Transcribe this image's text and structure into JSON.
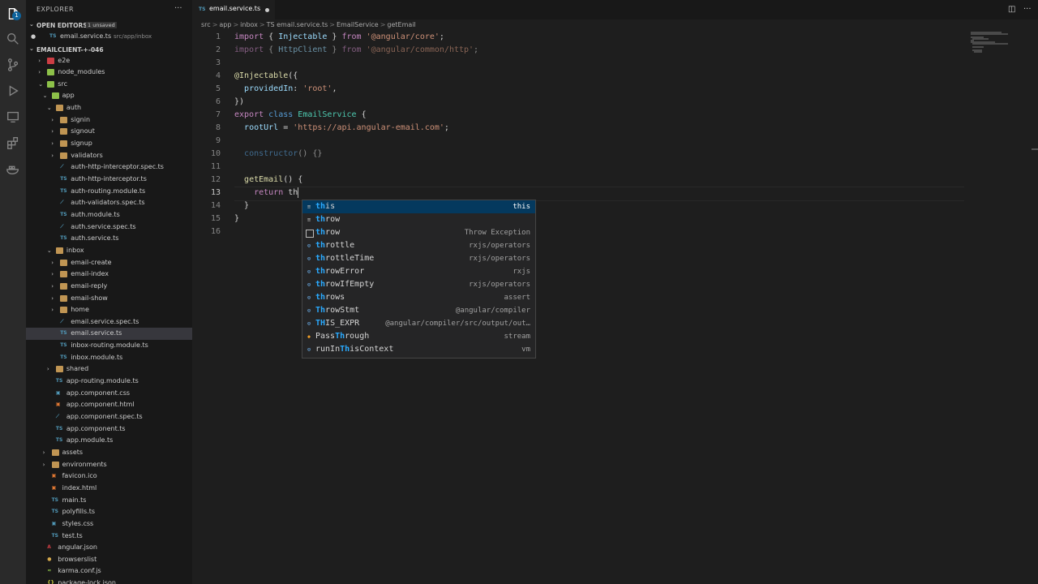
{
  "explorer": {
    "title": "EXPLORER",
    "more": "···",
    "open_editors": {
      "title": "OPEN EDITORS",
      "badge": "1 unsaved",
      "file": "email.service.ts",
      "path": "src/app/inbox",
      "dot": "●"
    },
    "project": "EMAILCLIENT-+-046",
    "tree": [
      {
        "label": "e2e",
        "type": "folder",
        "color": "red",
        "indent": 1,
        "chev": "›"
      },
      {
        "label": "node_modules",
        "type": "folder",
        "color": "green",
        "indent": 1,
        "chev": "›"
      },
      {
        "label": "src",
        "type": "folder",
        "color": "green",
        "indent": 1,
        "chev": "⌄"
      },
      {
        "label": "app",
        "type": "folder",
        "color": "green",
        "indent": 2,
        "chev": "⌄"
      },
      {
        "label": "auth",
        "type": "folder",
        "color": "",
        "indent": 3,
        "chev": "⌄"
      },
      {
        "label": "signin",
        "type": "folder",
        "color": "",
        "indent": 4,
        "chev": "›"
      },
      {
        "label": "signout",
        "type": "folder",
        "color": "",
        "indent": 4,
        "chev": "›"
      },
      {
        "label": "signup",
        "type": "folder",
        "color": "",
        "indent": 4,
        "chev": "›"
      },
      {
        "label": "validators",
        "type": "folder",
        "color": "",
        "indent": 4,
        "chev": "›"
      },
      {
        "label": "auth-http-interceptor.spec.ts",
        "type": "spec",
        "indent": 4
      },
      {
        "label": "auth-http-interceptor.ts",
        "type": "ts",
        "indent": 4
      },
      {
        "label": "auth-routing.module.ts",
        "type": "ts",
        "indent": 4
      },
      {
        "label": "auth-validators.spec.ts",
        "type": "spec",
        "indent": 4
      },
      {
        "label": "auth.module.ts",
        "type": "ts",
        "indent": 4
      },
      {
        "label": "auth.service.spec.ts",
        "type": "spec",
        "indent": 4
      },
      {
        "label": "auth.service.ts",
        "type": "ts",
        "indent": 4
      },
      {
        "label": "inbox",
        "type": "folder",
        "color": "",
        "indent": 3,
        "chev": "⌄"
      },
      {
        "label": "email-create",
        "type": "folder",
        "color": "",
        "indent": 4,
        "chev": "›"
      },
      {
        "label": "email-index",
        "type": "folder",
        "color": "",
        "indent": 4,
        "chev": "›"
      },
      {
        "label": "email-reply",
        "type": "folder",
        "color": "",
        "indent": 4,
        "chev": "›"
      },
      {
        "label": "email-show",
        "type": "folder",
        "color": "",
        "indent": 4,
        "chev": "›"
      },
      {
        "label": "home",
        "type": "folder",
        "color": "",
        "indent": 4,
        "chev": "›"
      },
      {
        "label": "email.service.spec.ts",
        "type": "spec",
        "indent": 4
      },
      {
        "label": "email.service.ts",
        "type": "ts",
        "indent": 4,
        "selected": true
      },
      {
        "label": "inbox-routing.module.ts",
        "type": "ts",
        "indent": 4
      },
      {
        "label": "inbox.module.ts",
        "type": "ts",
        "indent": 4
      },
      {
        "label": "shared",
        "type": "folder",
        "color": "",
        "indent": 3,
        "chev": "›"
      },
      {
        "label": "app-routing.module.ts",
        "type": "ts",
        "indent": 3
      },
      {
        "label": "app.component.css",
        "type": "css",
        "indent": 3
      },
      {
        "label": "app.component.html",
        "type": "html",
        "indent": 3
      },
      {
        "label": "app.component.spec.ts",
        "type": "spec",
        "indent": 3
      },
      {
        "label": "app.component.ts",
        "type": "ts",
        "indent": 3
      },
      {
        "label": "app.module.ts",
        "type": "ts",
        "indent": 3
      },
      {
        "label": "assets",
        "type": "folder",
        "color": "",
        "indent": 2,
        "chev": "›"
      },
      {
        "label": "environments",
        "type": "folder",
        "color": "",
        "indent": 2,
        "chev": "›"
      },
      {
        "label": "favicon.ico",
        "type": "img",
        "indent": 2
      },
      {
        "label": "index.html",
        "type": "html",
        "indent": 2
      },
      {
        "label": "main.ts",
        "type": "ts",
        "indent": 2
      },
      {
        "label": "polyfills.ts",
        "type": "ts",
        "indent": 2
      },
      {
        "label": "styles.css",
        "type": "css",
        "indent": 2
      },
      {
        "label": "test.ts",
        "type": "ts",
        "indent": 2
      },
      {
        "label": "angular.json",
        "type": "angular",
        "indent": 1
      },
      {
        "label": "browserslist",
        "type": "circle",
        "indent": 1
      },
      {
        "label": "karma.conf.js",
        "type": "karma",
        "indent": 1
      },
      {
        "label": "package-lock.json",
        "type": "json",
        "indent": 1
      }
    ]
  },
  "tab": {
    "icon": "TS",
    "label": "email.service.ts"
  },
  "breadcrumb": [
    "src",
    ">",
    "app",
    ">",
    "inbox",
    ">",
    "TS email.service.ts",
    ">",
    "EmailService",
    ">",
    "getEmail"
  ],
  "code_lines": [
    {
      "n": "1",
      "tokens": [
        [
          "kw",
          "import"
        ],
        [
          "punc",
          " { "
        ],
        [
          "prop",
          "Injectable"
        ],
        [
          "punc",
          " } "
        ],
        [
          "kw",
          "from"
        ],
        [
          "punc",
          " "
        ],
        [
          "str",
          "'@angular/core'"
        ],
        [
          "punc",
          ";"
        ]
      ]
    },
    {
      "n": "2",
      "tokens": [
        [
          "kw",
          "import"
        ],
        [
          "punc",
          " { "
        ],
        [
          "prop",
          "HttpClient"
        ],
        [
          "punc",
          " } "
        ],
        [
          "kw",
          "from"
        ],
        [
          "punc",
          " "
        ],
        [
          "str",
          "'@angular/common/http'"
        ],
        [
          "punc",
          ";"
        ]
      ],
      "dim": true
    },
    {
      "n": "3",
      "tokens": []
    },
    {
      "n": "4",
      "tokens": [
        [
          "dec",
          "@"
        ],
        [
          "fn",
          "Injectable"
        ],
        [
          "punc",
          "({"
        ]
      ]
    },
    {
      "n": "5",
      "tokens": [
        [
          "punc",
          "  "
        ],
        [
          "prop",
          "providedIn"
        ],
        [
          "punc",
          ": "
        ],
        [
          "str",
          "'root'"
        ],
        [
          "punc",
          ","
        ]
      ]
    },
    {
      "n": "6",
      "tokens": [
        [
          "punc",
          "})"
        ]
      ]
    },
    {
      "n": "7",
      "tokens": [
        [
          "kw",
          "export"
        ],
        [
          "punc",
          " "
        ],
        [
          "kw2",
          "class"
        ],
        [
          "punc",
          " "
        ],
        [
          "cls",
          "EmailService"
        ],
        [
          "punc",
          " {"
        ]
      ]
    },
    {
      "n": "8",
      "tokens": [
        [
          "punc",
          "  "
        ],
        [
          "prop",
          "rootUrl"
        ],
        [
          "punc",
          " = "
        ],
        [
          "str",
          "'https://api.angular-email.com'"
        ],
        [
          "punc",
          ";"
        ]
      ]
    },
    {
      "n": "9",
      "tokens": []
    },
    {
      "n": "10",
      "tokens": [
        [
          "punc",
          "  "
        ],
        [
          "kw2",
          "constructor"
        ],
        [
          "punc",
          "() {}"
        ]
      ],
      "dim": true
    },
    {
      "n": "11",
      "tokens": []
    },
    {
      "n": "12",
      "tokens": [
        [
          "punc",
          "  "
        ],
        [
          "fn",
          "getEmail"
        ],
        [
          "punc",
          "() {"
        ]
      ]
    },
    {
      "n": "13",
      "tokens": [
        [
          "punc",
          "    "
        ],
        [
          "kw",
          "return"
        ],
        [
          "punc",
          " th"
        ]
      ],
      "active": true
    },
    {
      "n": "14",
      "tokens": [
        [
          "punc",
          "  }"
        ]
      ]
    },
    {
      "n": "15",
      "tokens": [
        [
          "punc",
          "}"
        ]
      ]
    },
    {
      "n": "16",
      "tokens": []
    }
  ],
  "suggestions": [
    {
      "pre": "th",
      "rest": "is",
      "detail": "this",
      "icon": "≡",
      "kind": "kw",
      "selected": true
    },
    {
      "pre": "th",
      "rest": "row",
      "detail": "",
      "icon": "≡",
      "kind": "kw"
    },
    {
      "pre": "th",
      "rest": "row",
      "detail": "Throw Exception",
      "icon": "",
      "kind": "kwbox"
    },
    {
      "pre": "th",
      "rest": "rottle",
      "detail": "rxjs/operators",
      "icon": "⊙",
      "kind": "var"
    },
    {
      "pre": "th",
      "rest": "rottleTime",
      "detail": "rxjs/operators",
      "icon": "⊙",
      "kind": "var"
    },
    {
      "pre": "th",
      "rest": "rowError",
      "detail": "rxjs",
      "icon": "⊙",
      "kind": "var"
    },
    {
      "pre": "th",
      "rest": "rowIfEmpty",
      "detail": "rxjs/operators",
      "icon": "⊙",
      "kind": "var"
    },
    {
      "pre": "th",
      "rest": "rows",
      "detail": "assert",
      "icon": "⊙",
      "kind": "var"
    },
    {
      "pre": "Th",
      "rest": "rowStmt",
      "detail": "@angular/compiler",
      "icon": "⊙",
      "kind": "var"
    },
    {
      "pre": "TH",
      "rest": "IS_EXPR",
      "detail": "@angular/compiler/src/output/out…",
      "icon": "⊙",
      "kind": "var"
    },
    {
      "pre": "Pass",
      "rest": "Through",
      "detail": "stream",
      "icon": "◆",
      "kind": "cls",
      "split": true
    },
    {
      "pre": "runIn",
      "rest": "ThisContext",
      "detail": "vm",
      "icon": "⊙",
      "kind": "var",
      "split2": true
    }
  ]
}
